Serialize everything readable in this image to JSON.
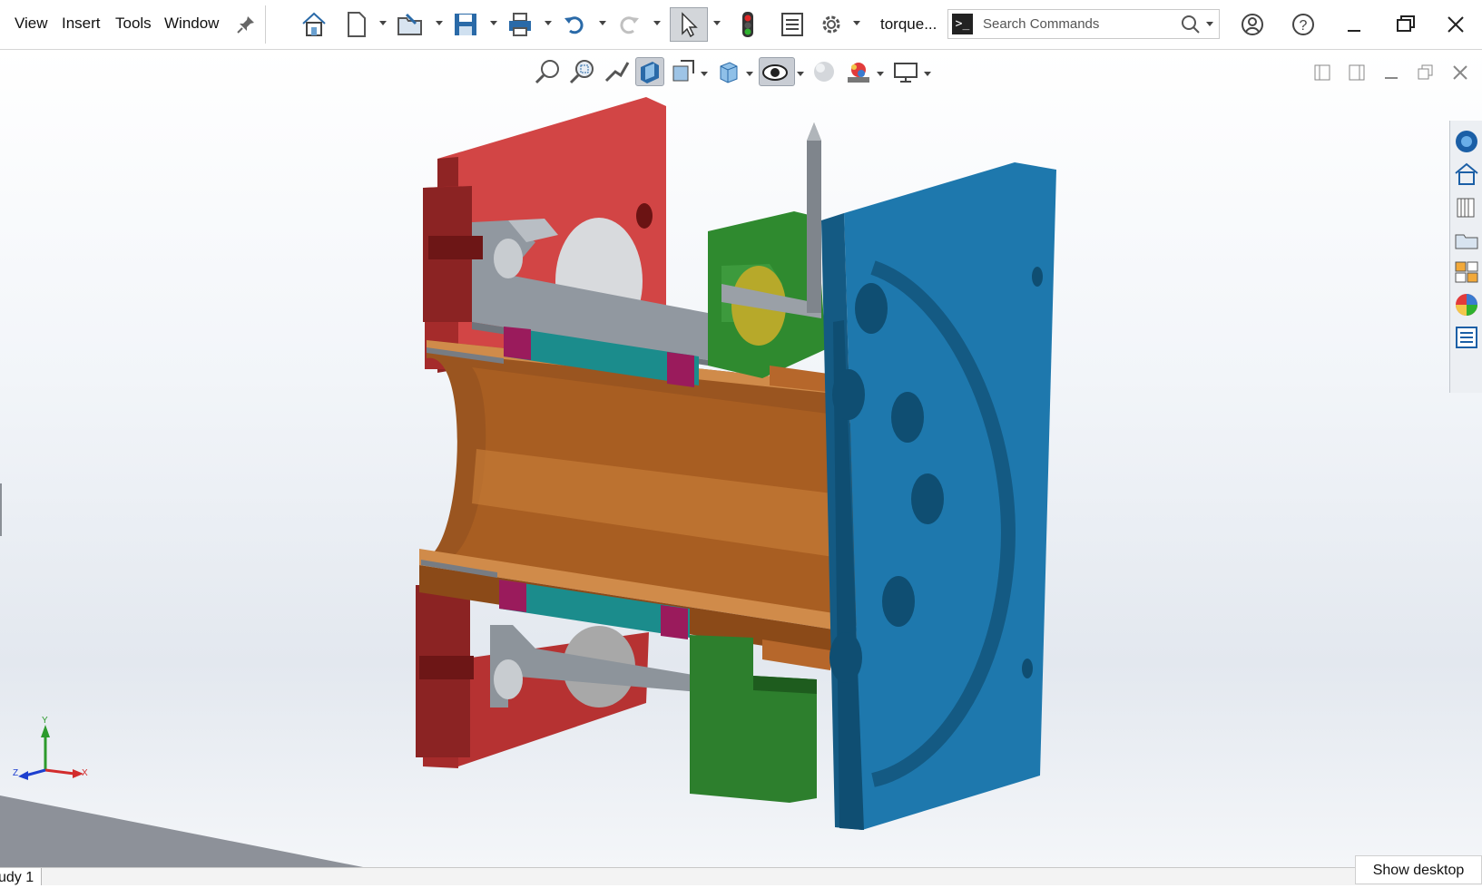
{
  "menu": {
    "items": [
      "View",
      "Insert",
      "Tools",
      "Window"
    ],
    "pin_icon": "pin-icon"
  },
  "toolbar": {
    "icons": [
      "home-icon",
      "new-document-icon",
      "open-icon",
      "save-icon",
      "print-icon",
      "undo-icon",
      "redo-icon",
      "select-arrow-icon",
      "rebuild-traffic-light-icon",
      "file-properties-icon",
      "options-gear-icon"
    ],
    "document_title": "torque..."
  },
  "search": {
    "placeholder": "Search Commands",
    "prompt_icon": "command-prompt-icon",
    "icon": "search-icon"
  },
  "window_controls": [
    "account-icon",
    "help-icon",
    "minimize-icon",
    "restore-icon",
    "close-icon"
  ],
  "heads_up": {
    "icons": [
      "zoom-to-fit-icon",
      "zoom-to-area-icon",
      "previous-view-icon",
      "section-view-icon",
      "dynamic-annotation-icon",
      "view-orientation-icon",
      "hide-show-items-icon",
      "edit-appearance-icon",
      "apply-scene-icon",
      "view-settings-icon"
    ]
  },
  "task_pane": {
    "icons": [
      "solidworks-resources-icon",
      "design-library-home-icon",
      "file-explorer-icon",
      "view-palette-icon",
      "appearances-icon",
      "custom-properties-icon",
      "task-list-icon"
    ]
  },
  "triad": {
    "y": "Y",
    "x": "X",
    "z": "Z"
  },
  "status": {
    "tab_label": "udy 1",
    "show_desktop": "Show desktop"
  },
  "colors": {
    "red_plate": "#c93a3a",
    "blue_plate": "#1b6fa0",
    "green_block": "#2f8a2f",
    "copper_tube": "#b66a2e",
    "steel_gray": "#8e949c",
    "teal_bearing": "#1b8c8c",
    "magenta_seal": "#9a1b5c"
  }
}
